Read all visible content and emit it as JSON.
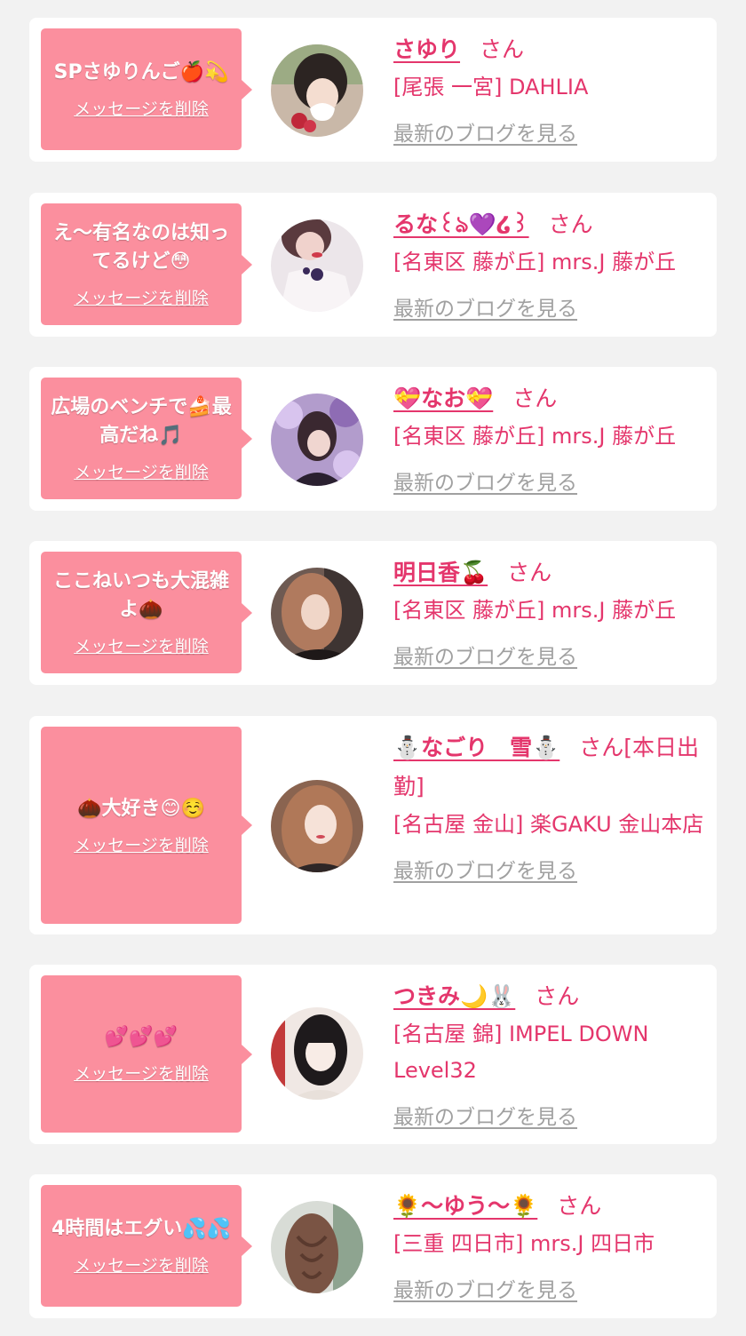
{
  "delete_label": "メッセージを削除",
  "blog_label": "最新のブログを見る",
  "san_label": "さん",
  "colors": {
    "accent": "#e4366c",
    "bubble": "#fb8f9e",
    "background": "#f2f2f2"
  },
  "items": [
    {
      "message": "SPさゆりんご🍎💫",
      "name": "さゆり",
      "suffix": "さん",
      "shop": "[尾張 一宮] DAHLIA"
    },
    {
      "message": "え〜有名なのは知ってるけど😳",
      "name": "るな꒰ঌ💜໒꒱",
      "suffix": "さん",
      "shop": "[名東区 藤が丘] mrs.J 藤が丘"
    },
    {
      "message": "広場のベンチで🍰最高だね🎵",
      "name": "💝なお💝",
      "suffix": "さん",
      "shop": "[名東区 藤が丘] mrs.J 藤が丘"
    },
    {
      "message": "ここねいつも大混雑よ🌰",
      "name": "明日香🍒",
      "suffix": "さん",
      "shop": "[名東区 藤が丘] mrs.J 藤が丘"
    },
    {
      "message": "🌰大好き😊☺️",
      "name": "⛄なごり　雪⛄",
      "suffix": "さん[本日出勤]",
      "shop": "[名古屋 金山] 楽GAKU 金山本店"
    },
    {
      "message": "💕💕💕",
      "name": "つきみ🌙🐰",
      "suffix": "さん",
      "shop": "[名古屋 錦] IMPEL DOWN Level32"
    },
    {
      "message": "4時間はエグい💦💦",
      "name": "🌻〜ゆう〜🌻",
      "suffix": "さん",
      "shop": "[三重 四日市] mrs.J 四日市"
    }
  ]
}
